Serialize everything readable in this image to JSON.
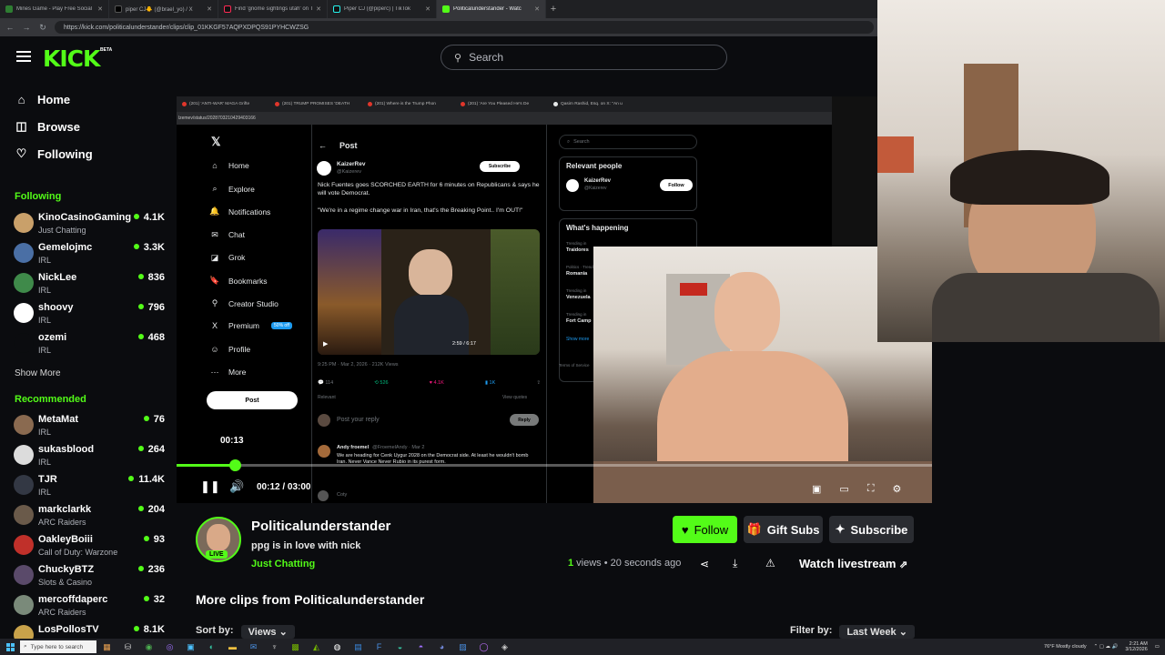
{
  "browser": {
    "tabs": [
      {
        "label": "Mines Game - Play Free Social Ca"
      },
      {
        "label": "piper CJ🐥 (@brael_yo) / X"
      },
      {
        "label": "Find 'gnome sightings utah' on Ti"
      },
      {
        "label": "Piper CJ (@piperc) | TikTok"
      },
      {
        "label": "Politicalunderstander - Watc"
      }
    ],
    "new_tab": "+",
    "url": "https://kick.com/politicalunderstander/clips/clip_01KKGF57AQPXDPQS91PYHCWZSG"
  },
  "header": {
    "logo": "KICK",
    "beta": "BETA",
    "search_placeholder": "Search"
  },
  "sidebar": {
    "nav": [
      {
        "label": "Home"
      },
      {
        "label": "Browse"
      },
      {
        "label": "Following"
      }
    ],
    "following_title": "Following",
    "following": [
      {
        "name": "KinoCasinoGaming",
        "category": "Just Chatting",
        "viewers": "4.1K",
        "color": "#c9a06a"
      },
      {
        "name": "Gemelojmc",
        "category": "IRL",
        "viewers": "3.3K",
        "color": "#4a6fa5"
      },
      {
        "name": "NickLee",
        "category": "IRL",
        "viewers": "836",
        "color": "#3f8a4a"
      },
      {
        "name": "shoovy",
        "category": "IRL",
        "viewers": "796",
        "color": "#ffffff"
      },
      {
        "name": "ozemi",
        "category": "IRL",
        "viewers": "468",
        "color": "#0b0c0f"
      }
    ],
    "show_more_1": "Show More",
    "recommended_title": "Recommended",
    "recommended": [
      {
        "name": "MetaMat",
        "category": "IRL",
        "viewers": "76",
        "color": "#8a6a50"
      },
      {
        "name": "sukasblood",
        "category": "IRL",
        "viewers": "264",
        "color": "#dcdcdc"
      },
      {
        "name": "TJR",
        "category": "IRL",
        "viewers": "11.4K",
        "color": "#333844"
      },
      {
        "name": "markclarkk",
        "category": "ARC Raiders",
        "viewers": "204",
        "color": "#6a5a4a"
      },
      {
        "name": "OakleyBoiii",
        "category": "Call of Duty: Warzone",
        "viewers": "93",
        "color": "#c0302a"
      },
      {
        "name": "ChuckyBTZ",
        "category": "Slots & Casino",
        "viewers": "236",
        "color": "#5a4a6a"
      },
      {
        "name": "mercoffdaperc",
        "category": "ARC Raiders",
        "viewers": "32",
        "color": "#7a8a7a"
      },
      {
        "name": "LosPollosTV",
        "category": "",
        "viewers": "8.1K",
        "color": "#c8a24a"
      }
    ]
  },
  "embedded": {
    "tabs": [
      {
        "label": "(201) 'ANTI-WAR' MAGA Grifte"
      },
      {
        "label": "(201) TRUMP PROMISES 'DEATH"
      },
      {
        "label": "(201) Where is the Trump Phon"
      },
      {
        "label": "(201) 'Are You Pleased He's De"
      },
      {
        "label": "Qasim Rashid, Esq. on X: \"An u"
      }
    ],
    "url": "lzemev/status/2028703210429403166",
    "x_nav": [
      {
        "label": "Home",
        "icon": "⌂"
      },
      {
        "label": "Explore",
        "icon": "⌕"
      },
      {
        "label": "Notifications",
        "icon": "🔔"
      },
      {
        "label": "Chat",
        "icon": "✉"
      },
      {
        "label": "Grok",
        "icon": "◪"
      },
      {
        "label": "Bookmarks",
        "icon": "🔖"
      },
      {
        "label": "Creator Studio",
        "icon": "⚲"
      },
      {
        "label": "Premium",
        "icon": "X"
      },
      {
        "label": "Profile",
        "icon": "☺"
      },
      {
        "label": "More",
        "icon": "⋯"
      }
    ],
    "premium_badge": "50% off",
    "post_button": "Post",
    "post_header": "Post",
    "author": "KaizerRev",
    "handle": "@Kaizerev",
    "subscribe": "Subscribe",
    "tweet_text": "Nick Fuentes goes SCORCHED EARTH for 6 minutes on Republicans & says he will vote Democrat.",
    "tweet_quote": "\"We're in a regime change war in Iran, that's the Breaking Point.. I'm OUT!\"",
    "media_time": "2:59 / 6:17",
    "tweet_meta": "9:25 PM · Mar 2, 2026 · 212K Views",
    "stats": {
      "replies": "114",
      "reposts": "526",
      "likes": "4.1K",
      "bookmarks": "1K"
    },
    "relevant_label": "Relevant",
    "view_quotes": "View quotes",
    "reply_placeholder": "Post your reply",
    "reply_button": "Reply",
    "reply_author": "Andy froemel",
    "reply_handle": "@FroemelAndy · Mar 2",
    "reply_text": "We are heading for Cenk Uygur 2028 on the Democrat side. At least he wouldn't bomb Iran. Never Vance Never Rubio in its purest form.",
    "reply2_author": "Coty",
    "search": "Search",
    "relevant_people": "Relevant people",
    "follow": "Follow",
    "whats_happening": "What's happening",
    "trending": [
      {
        "ctx": "Trending in",
        "name": "Traidores"
      },
      {
        "ctx": "Politics · Trending",
        "name": "Romania"
      },
      {
        "ctx": "Trending in",
        "name": "Venezuela"
      },
      {
        "ctx": "Trending in",
        "name": "Fort Camp"
      }
    ],
    "show_more": "Show more",
    "terms": "Terms of Service"
  },
  "player": {
    "hover_time": "00:13",
    "time": "00:12 / 03:00",
    "progress": 0.077
  },
  "clip": {
    "channel": "Politicalunderstander",
    "live": "LIVE",
    "title": "ppg is in love with nick",
    "category": "Just Chatting",
    "views_count": "1",
    "views_label": " views",
    "age": " • 20 seconds ago",
    "follow": "Follow",
    "gift_subs": "Gift Subs",
    "subscribe": "Subscribe",
    "watch_livestream": "Watch livestream",
    "more_clips": "More clips from Politicalunderstander",
    "sort_label": "Sort by:",
    "sort_value": "Views",
    "filter_label": "Filter by:",
    "filter_value": "Last Week"
  },
  "taskbar": {
    "search_placeholder": "Type here to search",
    "weather": "76°F  Mostly cloudy",
    "time": "2:21 AM",
    "date": "3/12/2026"
  },
  "colors": {
    "accent": "#53fc18",
    "background": "#0b0c0f"
  }
}
